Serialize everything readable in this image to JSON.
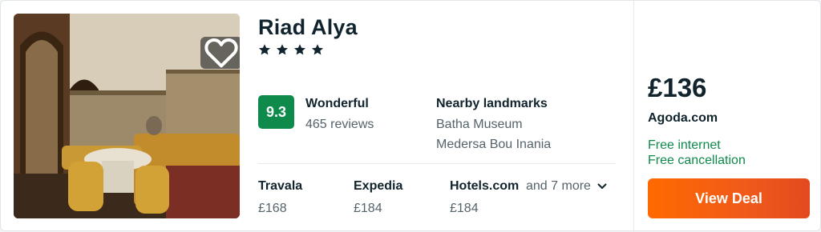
{
  "hotel": {
    "name": "Riad Alya",
    "star_count": 4,
    "rating": {
      "score": "9.3",
      "word": "Wonderful",
      "reviews": "465 reviews",
      "score_color": "#0e8a4a"
    },
    "nearby": {
      "heading": "Nearby landmarks",
      "items": [
        "Batha Museum",
        "Medersa Bou Inania"
      ]
    },
    "photo": {
      "alt_icon": "hotel-interior-photo"
    },
    "favorite_icon": "heart-icon"
  },
  "providers": [
    {
      "name": "Travala",
      "price": "£168"
    },
    {
      "name": "Expedia",
      "price": "£184"
    },
    {
      "name": "Hotels.com",
      "price": "£184"
    }
  ],
  "more_providers": {
    "label": "and 7 more",
    "icon": "chevron-down-icon"
  },
  "deal": {
    "price": "£136",
    "provider": "Agoda.com",
    "perks": [
      "Free internet",
      "Free cancellation"
    ],
    "button_label": "View Deal",
    "button_color": "#f05a1a",
    "perk_color": "#0e8a4a"
  }
}
